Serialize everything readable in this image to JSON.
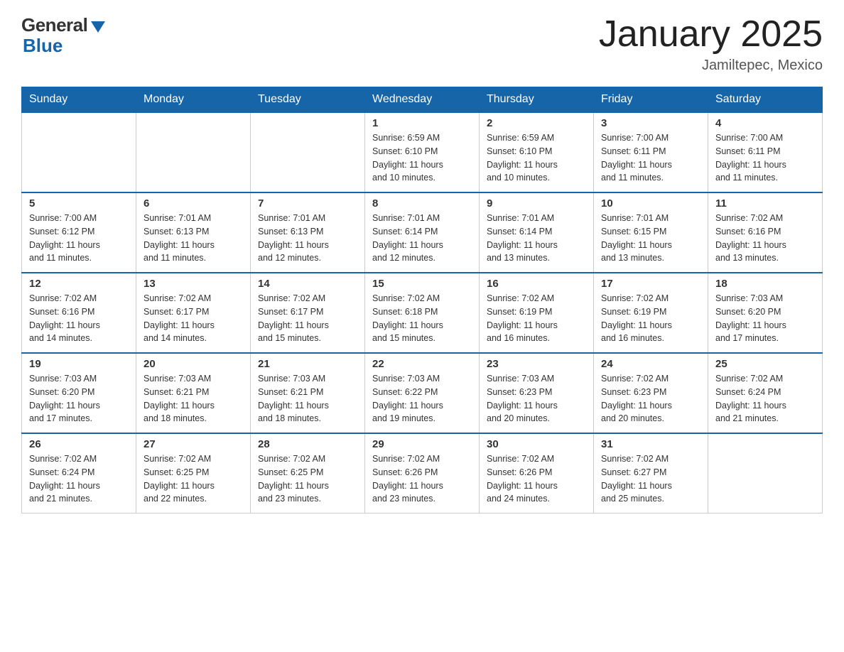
{
  "header": {
    "logo_general": "General",
    "logo_blue": "Blue",
    "title": "January 2025",
    "subtitle": "Jamiltepec, Mexico"
  },
  "days_header": [
    "Sunday",
    "Monday",
    "Tuesday",
    "Wednesday",
    "Thursday",
    "Friday",
    "Saturday"
  ],
  "weeks": [
    [
      {
        "day": "",
        "info": ""
      },
      {
        "day": "",
        "info": ""
      },
      {
        "day": "",
        "info": ""
      },
      {
        "day": "1",
        "info": "Sunrise: 6:59 AM\nSunset: 6:10 PM\nDaylight: 11 hours\nand 10 minutes."
      },
      {
        "day": "2",
        "info": "Sunrise: 6:59 AM\nSunset: 6:10 PM\nDaylight: 11 hours\nand 10 minutes."
      },
      {
        "day": "3",
        "info": "Sunrise: 7:00 AM\nSunset: 6:11 PM\nDaylight: 11 hours\nand 11 minutes."
      },
      {
        "day": "4",
        "info": "Sunrise: 7:00 AM\nSunset: 6:11 PM\nDaylight: 11 hours\nand 11 minutes."
      }
    ],
    [
      {
        "day": "5",
        "info": "Sunrise: 7:00 AM\nSunset: 6:12 PM\nDaylight: 11 hours\nand 11 minutes."
      },
      {
        "day": "6",
        "info": "Sunrise: 7:01 AM\nSunset: 6:13 PM\nDaylight: 11 hours\nand 11 minutes."
      },
      {
        "day": "7",
        "info": "Sunrise: 7:01 AM\nSunset: 6:13 PM\nDaylight: 11 hours\nand 12 minutes."
      },
      {
        "day": "8",
        "info": "Sunrise: 7:01 AM\nSunset: 6:14 PM\nDaylight: 11 hours\nand 12 minutes."
      },
      {
        "day": "9",
        "info": "Sunrise: 7:01 AM\nSunset: 6:14 PM\nDaylight: 11 hours\nand 13 minutes."
      },
      {
        "day": "10",
        "info": "Sunrise: 7:01 AM\nSunset: 6:15 PM\nDaylight: 11 hours\nand 13 minutes."
      },
      {
        "day": "11",
        "info": "Sunrise: 7:02 AM\nSunset: 6:16 PM\nDaylight: 11 hours\nand 13 minutes."
      }
    ],
    [
      {
        "day": "12",
        "info": "Sunrise: 7:02 AM\nSunset: 6:16 PM\nDaylight: 11 hours\nand 14 minutes."
      },
      {
        "day": "13",
        "info": "Sunrise: 7:02 AM\nSunset: 6:17 PM\nDaylight: 11 hours\nand 14 minutes."
      },
      {
        "day": "14",
        "info": "Sunrise: 7:02 AM\nSunset: 6:17 PM\nDaylight: 11 hours\nand 15 minutes."
      },
      {
        "day": "15",
        "info": "Sunrise: 7:02 AM\nSunset: 6:18 PM\nDaylight: 11 hours\nand 15 minutes."
      },
      {
        "day": "16",
        "info": "Sunrise: 7:02 AM\nSunset: 6:19 PM\nDaylight: 11 hours\nand 16 minutes."
      },
      {
        "day": "17",
        "info": "Sunrise: 7:02 AM\nSunset: 6:19 PM\nDaylight: 11 hours\nand 16 minutes."
      },
      {
        "day": "18",
        "info": "Sunrise: 7:03 AM\nSunset: 6:20 PM\nDaylight: 11 hours\nand 17 minutes."
      }
    ],
    [
      {
        "day": "19",
        "info": "Sunrise: 7:03 AM\nSunset: 6:20 PM\nDaylight: 11 hours\nand 17 minutes."
      },
      {
        "day": "20",
        "info": "Sunrise: 7:03 AM\nSunset: 6:21 PM\nDaylight: 11 hours\nand 18 minutes."
      },
      {
        "day": "21",
        "info": "Sunrise: 7:03 AM\nSunset: 6:21 PM\nDaylight: 11 hours\nand 18 minutes."
      },
      {
        "day": "22",
        "info": "Sunrise: 7:03 AM\nSunset: 6:22 PM\nDaylight: 11 hours\nand 19 minutes."
      },
      {
        "day": "23",
        "info": "Sunrise: 7:03 AM\nSunset: 6:23 PM\nDaylight: 11 hours\nand 20 minutes."
      },
      {
        "day": "24",
        "info": "Sunrise: 7:02 AM\nSunset: 6:23 PM\nDaylight: 11 hours\nand 20 minutes."
      },
      {
        "day": "25",
        "info": "Sunrise: 7:02 AM\nSunset: 6:24 PM\nDaylight: 11 hours\nand 21 minutes."
      }
    ],
    [
      {
        "day": "26",
        "info": "Sunrise: 7:02 AM\nSunset: 6:24 PM\nDaylight: 11 hours\nand 21 minutes."
      },
      {
        "day": "27",
        "info": "Sunrise: 7:02 AM\nSunset: 6:25 PM\nDaylight: 11 hours\nand 22 minutes."
      },
      {
        "day": "28",
        "info": "Sunrise: 7:02 AM\nSunset: 6:25 PM\nDaylight: 11 hours\nand 23 minutes."
      },
      {
        "day": "29",
        "info": "Sunrise: 7:02 AM\nSunset: 6:26 PM\nDaylight: 11 hours\nand 23 minutes."
      },
      {
        "day": "30",
        "info": "Sunrise: 7:02 AM\nSunset: 6:26 PM\nDaylight: 11 hours\nand 24 minutes."
      },
      {
        "day": "31",
        "info": "Sunrise: 7:02 AM\nSunset: 6:27 PM\nDaylight: 11 hours\nand 25 minutes."
      },
      {
        "day": "",
        "info": ""
      }
    ]
  ]
}
